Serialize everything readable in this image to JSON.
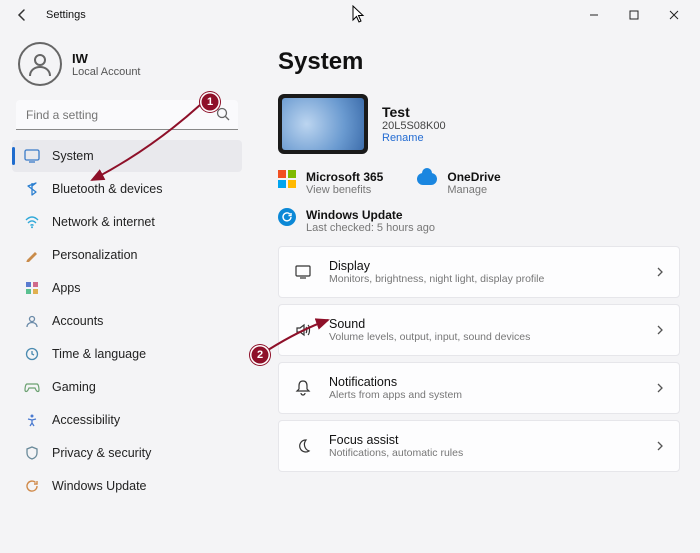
{
  "window": {
    "title": "Settings"
  },
  "account": {
    "name": "IW",
    "sub": "Local Account"
  },
  "search": {
    "placeholder": "Find a setting"
  },
  "sidebar": {
    "items": [
      {
        "label": "System"
      },
      {
        "label": "Bluetooth & devices"
      },
      {
        "label": "Network & internet"
      },
      {
        "label": "Personalization"
      },
      {
        "label": "Apps"
      },
      {
        "label": "Accounts"
      },
      {
        "label": "Time & language"
      },
      {
        "label": "Gaming"
      },
      {
        "label": "Accessibility"
      },
      {
        "label": "Privacy & security"
      },
      {
        "label": "Windows Update"
      }
    ]
  },
  "page": {
    "title": "System",
    "device": {
      "name": "Test",
      "model": "20L5S08K00",
      "rename": "Rename"
    },
    "m365": {
      "title": "Microsoft 365",
      "sub": "View benefits"
    },
    "onedrive": {
      "title": "OneDrive",
      "sub": "Manage"
    },
    "update": {
      "title": "Windows Update",
      "sub": "Last checked: 5 hours ago"
    },
    "cards": [
      {
        "title": "Display",
        "sub": "Monitors, brightness, night light, display profile"
      },
      {
        "title": "Sound",
        "sub": "Volume levels, output, input, sound devices"
      },
      {
        "title": "Notifications",
        "sub": "Alerts from apps and system"
      },
      {
        "title": "Focus assist",
        "sub": "Notifications, automatic rules"
      }
    ]
  },
  "annotations": {
    "badge1": "1",
    "badge2": "2"
  }
}
